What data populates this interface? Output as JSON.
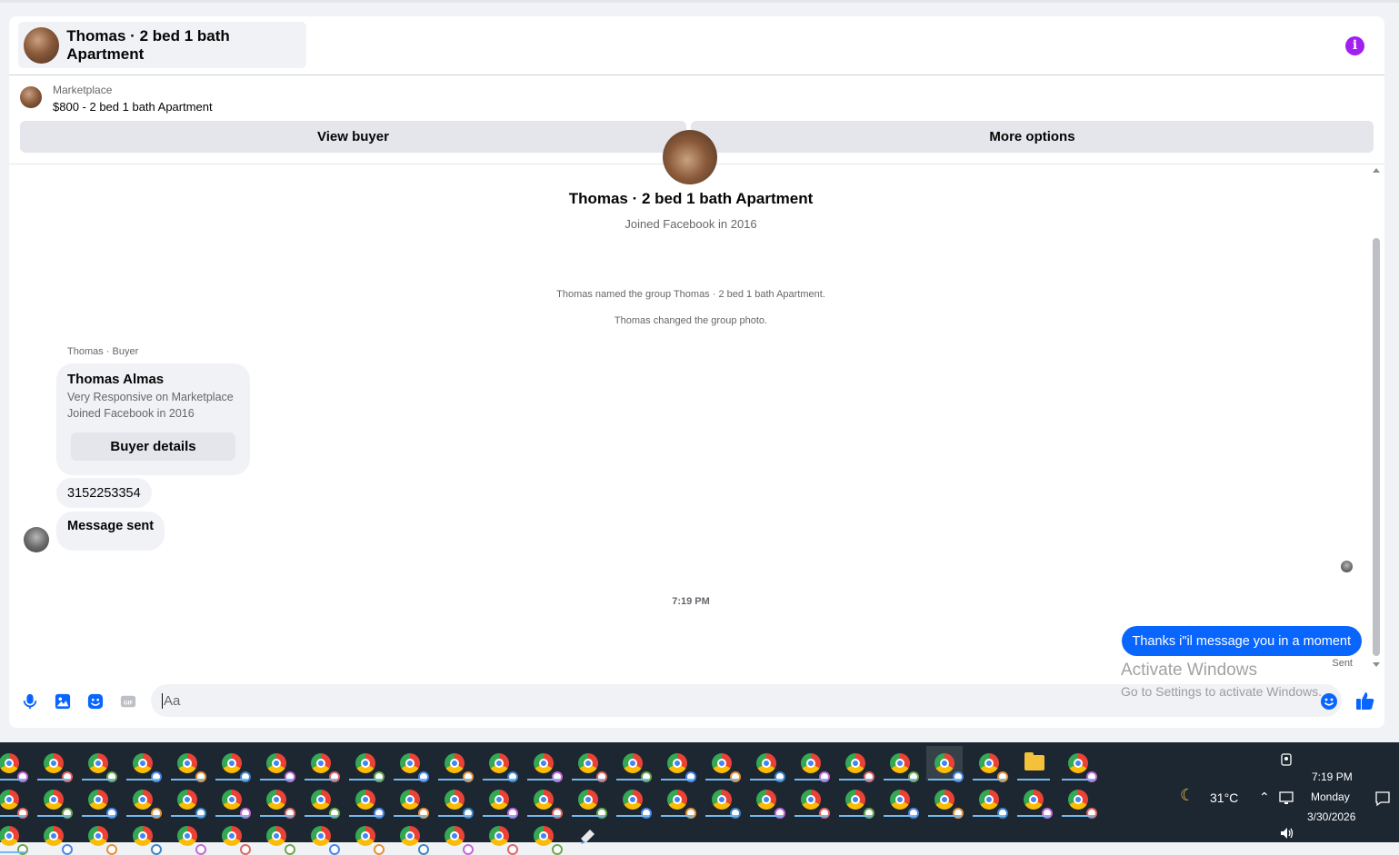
{
  "header": {
    "title": "Thomas · 2 bed 1 bath Apartment",
    "info_icon": "i"
  },
  "marketplace": {
    "label": "Marketplace",
    "listing": "$800 - 2 bed 1 bath Apartment",
    "view_buyer": "View buyer",
    "more_options": "More options"
  },
  "chat": {
    "title": "Thomas · 2 bed 1 bath Apartment",
    "joined": "Joined Facebook in 2016",
    "system_messages": [
      "Thomas named the group Thomas · 2 bed 1 bath Apartment.",
      "Thomas changed the group photo."
    ],
    "sender_label": "Thomas · Buyer",
    "buyer_card": {
      "name": "Thomas Almas",
      "line1": "Very Responsive on Marketplace",
      "line2": "Joined Facebook in 2016",
      "button": "Buyer details"
    },
    "incoming": [
      "3152253354",
      "Message sent"
    ],
    "timestamp": "7:19 PM",
    "outgoing": "Thanks i\"il message you in a moment",
    "sent_status": "Sent"
  },
  "composer": {
    "placeholder": "Aa",
    "icons": [
      "microphone-icon",
      "image-icon",
      "sticker-icon",
      "gif-icon",
      "emoji-icon",
      "like-icon"
    ]
  },
  "watermark": {
    "line1": "Activate Windows",
    "line2": "Go to Settings to activate Windows."
  },
  "taskbar": {
    "weather": "31°C",
    "time": "7:19 PM",
    "day": "Monday",
    "date": "3/30/2026"
  },
  "colors": {
    "accent": "#0866ff",
    "info": "#a020f0",
    "bubble_in": "#f0f2f5",
    "taskbar": "#1c2732"
  }
}
